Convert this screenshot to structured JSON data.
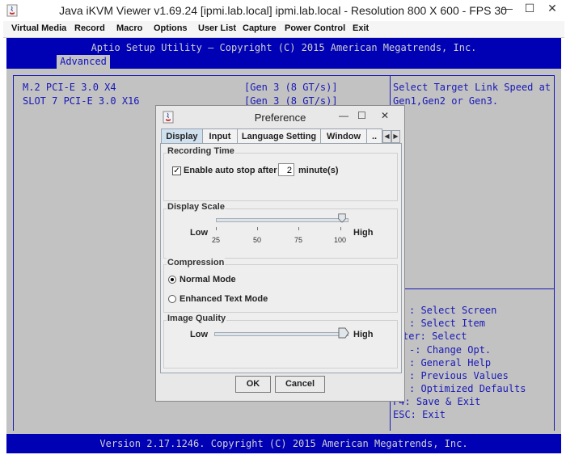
{
  "window": {
    "title": "Java iKVM Viewer v1.69.24 [ipmi.lab.local] ipmi.lab.local - Resolution 800 X 600 - FPS 30",
    "controls": [
      "—",
      "☐",
      "✕"
    ]
  },
  "menubar": {
    "items": [
      "Virtual Media",
      "Record",
      "Macro",
      "Options",
      "User List",
      "Capture",
      "Power Control",
      "Exit"
    ]
  },
  "bios": {
    "header": "Aptio Setup Utility – Copyright (C) 2015 American Megatrends, Inc.",
    "active_tab": "Advanced",
    "rows": [
      {
        "label": "M.2 PCI-E 3.0 X4",
        "value": "[Gen 3 (8 GT/s)]"
      },
      {
        "label": "SLOT 7 PCI-E 3.0 X16",
        "value": "[Gen 3 (8 GT/s)]"
      }
    ],
    "help_lines": [
      "Select Target Link Speed at",
      "Gen1,Gen2 or Gen3."
    ],
    "keys": [
      ": Select Screen",
      ": Select Item",
      "ter: Select",
      "-: Change Opt.",
      ": General Help",
      ": Previous Values",
      ": Optimized Defaults",
      "F4: Save & Exit",
      "ESC: Exit"
    ],
    "footer": "Version 2.17.1246. Copyright (C) 2015 American Megatrends, Inc."
  },
  "dialog": {
    "title": "Preference",
    "tabs": [
      "Display",
      "Input",
      "Language Setting",
      "Window",
      ".."
    ],
    "recording": {
      "title": "Recording Time",
      "checkbox_label": "Enable auto stop after",
      "checked": true,
      "minutes": "2",
      "unit": "minute(s)"
    },
    "scale": {
      "title": "Display Scale",
      "low": "Low",
      "high": "High",
      "ticks": [
        "25",
        "50",
        "75",
        "100"
      ],
      "value": 100
    },
    "compression": {
      "title": "Compression",
      "options": [
        "Normal Mode",
        "Enhanced Text Mode"
      ],
      "selected": 0
    },
    "quality": {
      "title": "Image Quality",
      "low": "Low",
      "high": "High",
      "value": 1.0
    },
    "ok": "OK",
    "cancel": "Cancel"
  }
}
